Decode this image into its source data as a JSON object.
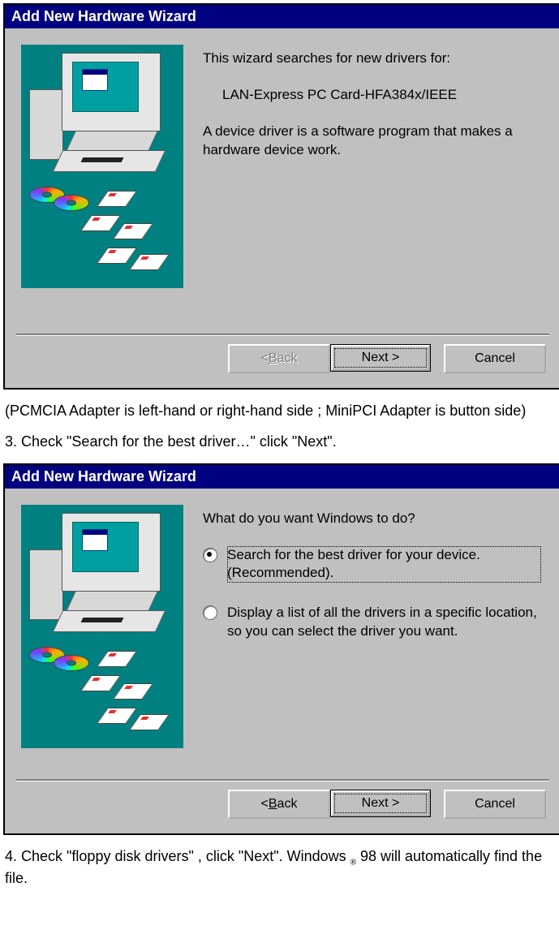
{
  "dialog1": {
    "title": "Add New Hardware Wizard",
    "intro": "This wizard searches for new drivers for:",
    "device": "LAN-Express PC Card-HFA384x/IEEE",
    "desc": "A device driver is a software program that makes a hardware device work.",
    "back": "Back",
    "next": "Next >",
    "cancel": "Cancel"
  },
  "caption1": "(PCMCIA Adapter is left-hand or right-hand side ; MiniPCI Adapter is button side)",
  "step3": "3. Check \"Search for the best driver…\" click \"Next\".",
  "dialog2": {
    "title": "Add New Hardware Wizard",
    "question": "What do you want Windows to do?",
    "opt1": "Search for the best driver for your device. (Recommended).",
    "opt2": "Display a list of all the drivers in a specific location, so you can select the driver you want.",
    "back": "Back",
    "next": "Next >",
    "cancel": "Cancel"
  },
  "step4_a": "4. Check \"floppy disk drivers\" , click \"Next\". Windows ",
  "step4_reg": "®",
  "step4_b": " 98 will automatically find the file."
}
